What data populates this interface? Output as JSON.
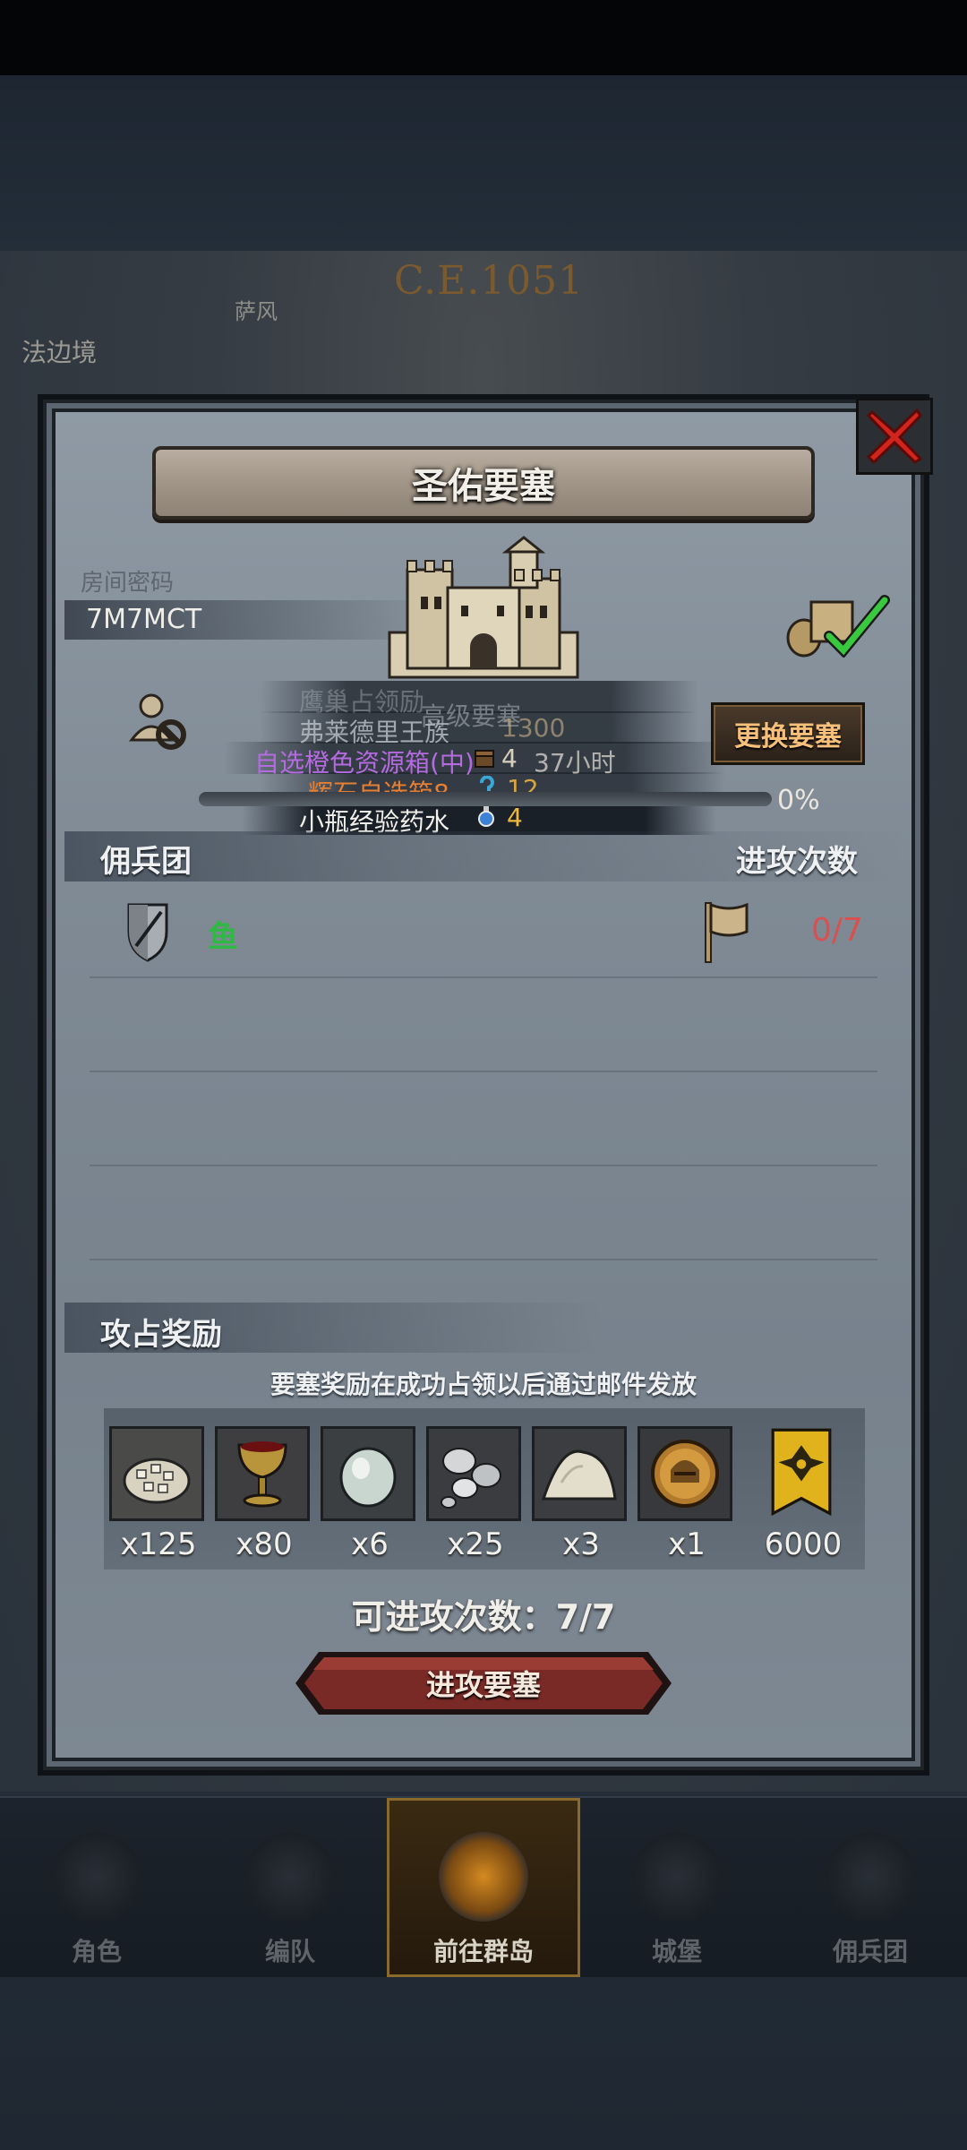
{
  "map": {
    "era": "C.E.1051",
    "label_top": "萨风",
    "label_left": "法边境"
  },
  "dialog": {
    "title": "圣佑要塞",
    "room_label": "房间密码",
    "room_code": "7M7MCT",
    "change_button": "更换要塞",
    "progress": {
      "value_percent": 0,
      "text": "0%"
    }
  },
  "notifications": {
    "hidden_line": "鹰巢占领励",
    "tier": "高级要塞",
    "owner": "弗莱德里王族",
    "owner_value": "1300",
    "chest": "自选橙色资源箱(中)",
    "chest_count": "4",
    "chest_time": "37小时",
    "stone": "辉石自选箱8",
    "stone_count": "12",
    "potion": "小瓶经验药水",
    "potion_count": "4"
  },
  "mercenary": {
    "header": "佣兵团",
    "attack_header": "进攻次数",
    "rows": [
      {
        "name": "鱼",
        "count": "0/7"
      }
    ]
  },
  "rewards": {
    "header": "攻占奖励",
    "note": "要塞奖励在成功占领以后通过邮件发放",
    "items": [
      {
        "icon": "grain-sack-icon",
        "qty": "x125"
      },
      {
        "icon": "goblet-icon",
        "qty": "x80"
      },
      {
        "icon": "gem-stone-icon",
        "qty": "x6"
      },
      {
        "icon": "silver-ore-icon",
        "qty": "x25"
      },
      {
        "icon": "salt-pile-icon",
        "qty": "x3"
      },
      {
        "icon": "knight-helmet-coin-icon",
        "qty": "x1"
      },
      {
        "icon": "banner-emblem-icon",
        "qty": "6000"
      }
    ]
  },
  "attempts": "可进攻次数：7/7",
  "attack_button": "进攻要塞",
  "nav": [
    {
      "label": "角色",
      "icon": "knight-icon",
      "active": false
    },
    {
      "label": "编队",
      "icon": "helmet-icon",
      "active": false
    },
    {
      "label": "前往群岛",
      "icon": "compass-icon",
      "active": true
    },
    {
      "label": "城堡",
      "icon": "castle-icon",
      "active": false
    },
    {
      "label": "佣兵团",
      "icon": "soldier-icon",
      "active": false
    }
  ],
  "colors": {
    "merc_name": "#2fb844",
    "attack_count": "#d85050",
    "chest_text": "#b56be0",
    "stone_text": "#e77f33",
    "change_button_text": "#f6c07a"
  }
}
